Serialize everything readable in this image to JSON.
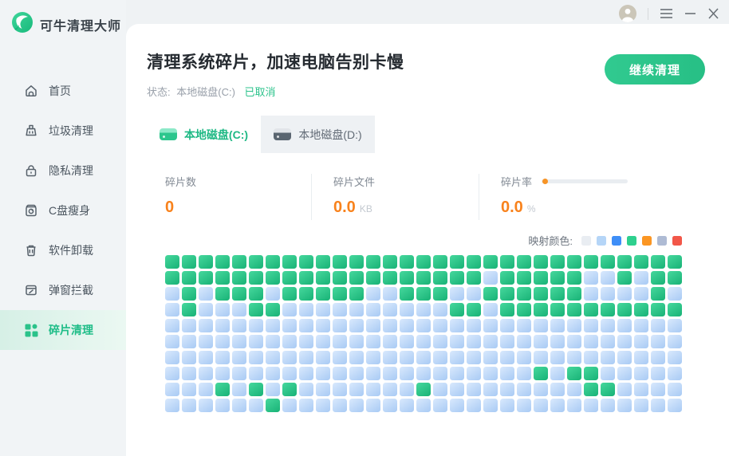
{
  "app": {
    "name": "可牛清理大师"
  },
  "sidebar": {
    "items": [
      {
        "label": "首页",
        "icon": "home",
        "active": false
      },
      {
        "label": "垃圾清理",
        "icon": "broom",
        "active": false
      },
      {
        "label": "隐私清理",
        "icon": "lock",
        "active": false
      },
      {
        "label": "C盘瘦身",
        "icon": "disk-slim",
        "active": false
      },
      {
        "label": "软件卸载",
        "icon": "trash",
        "active": false
      },
      {
        "label": "弹窗拦截",
        "icon": "popup-block",
        "active": false
      },
      {
        "label": "碎片清理",
        "icon": "fragments",
        "active": true
      }
    ]
  },
  "window_controls": {
    "icons": [
      "user-avatar",
      "menu-icon",
      "minimize-icon",
      "close-icon"
    ]
  },
  "header": {
    "title": "清理系统碎片，加速电脑告别卡慢",
    "status_label": "状态:",
    "status_disk": "本地磁盘(C:)",
    "status_state": "已取消",
    "action_button": "继续清理"
  },
  "tabs": [
    {
      "label": "本地磁盘(C:)",
      "active": true
    },
    {
      "label": "本地磁盘(D:)",
      "active": false
    }
  ],
  "stats": [
    {
      "label": "碎片数",
      "value": "0",
      "unit": "",
      "slider": false
    },
    {
      "label": "碎片文件",
      "value": "0.0",
      "unit": "KB",
      "slider": false
    },
    {
      "label": "碎片率",
      "value": "0.0",
      "unit": "%",
      "slider": true
    }
  ],
  "legend": {
    "label": "映射颜色:",
    "colors": [
      "#e9edf2",
      "#b5d5f7",
      "#3e8ef7",
      "#2ed08e",
      "#fb9623",
      "#aebbd4",
      "#f25749"
    ]
  },
  "grid": {
    "cell_green": [
      "#46d89d",
      "#18b276"
    ],
    "cell_blue": [
      "#d9e9fd",
      "#a8caf4"
    ],
    "rows": [
      "GGGGGGGGGGGGGGGGGGGGGGGGGGGGGGG",
      "GGGGGGGGGGGGGGGGGGGBGGGGGBBGBGG",
      "BGBGGGBGGGGGBBGGGBBGGGGGGBBBBGB",
      "BGBBBGGBBBBBBBBBBGGBGGGGGGGGGGG",
      "BBBBBBBBBBBBBBBBBBBBBBBBBBBBBBB",
      "BBBBBBBBBBBBBBBBBBBBBBBBBBBBBBB",
      "BBBBBBBBBBBBBBBBBBBBBBBBBBBBBBB",
      "BBBBBBBBBBBBBBBBBBBBBBGBGGBBBBB",
      "BBBGBGBGBBBBBBBGBBBBBBBBBGGBBBB",
      "BBBBBBGBBBBBBBBBBBBBBBBBBBBBBBB"
    ]
  },
  "accent": {
    "green": "#2bc28a",
    "orange": "#f78a1d"
  }
}
